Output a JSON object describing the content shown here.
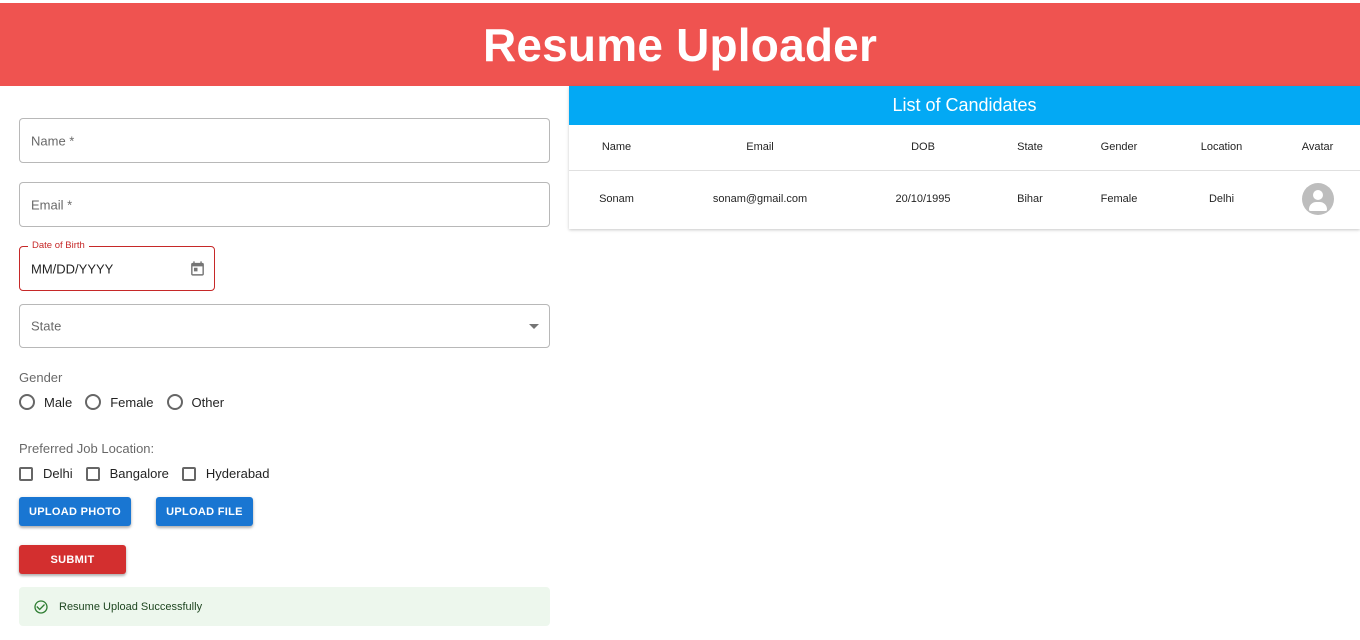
{
  "header": {
    "title": "Resume Uploader"
  },
  "form": {
    "name_placeholder": "Name *",
    "email_placeholder": "Email *",
    "dob_label": "Date of Birth",
    "dob_value": "MM/DD/YYYY",
    "state_placeholder": "State",
    "gender_label": "Gender",
    "gender_options": [
      "Male",
      "Female",
      "Other"
    ],
    "location_label": "Preferred Job Location:",
    "location_options": [
      "Delhi",
      "Bangalore",
      "Hyderabad"
    ],
    "upload_photo_label": "UPLOAD PHOTO",
    "upload_file_label": "UPLOAD FILE",
    "submit_label": "SUBMIT",
    "alert_message": "Resume Upload Successfully"
  },
  "candidates": {
    "title": "List of Candidates",
    "columns": [
      "Name",
      "Email",
      "DOB",
      "State",
      "Gender",
      "Location",
      "Avatar"
    ],
    "rows": [
      {
        "name": "Sonam",
        "email": "sonam@gmail.com",
        "dob": "20/10/1995",
        "state": "Bihar",
        "gender": "Female",
        "location": "Delhi"
      }
    ]
  },
  "colors": {
    "header_bg": "#ef5350",
    "panel_title_bg": "#03a9f4",
    "primary_button": "#1976d2",
    "submit_button": "#d32f2f",
    "error": "#c62828",
    "success_bg": "#edf7ed",
    "success_icon": "#2e7d32"
  }
}
